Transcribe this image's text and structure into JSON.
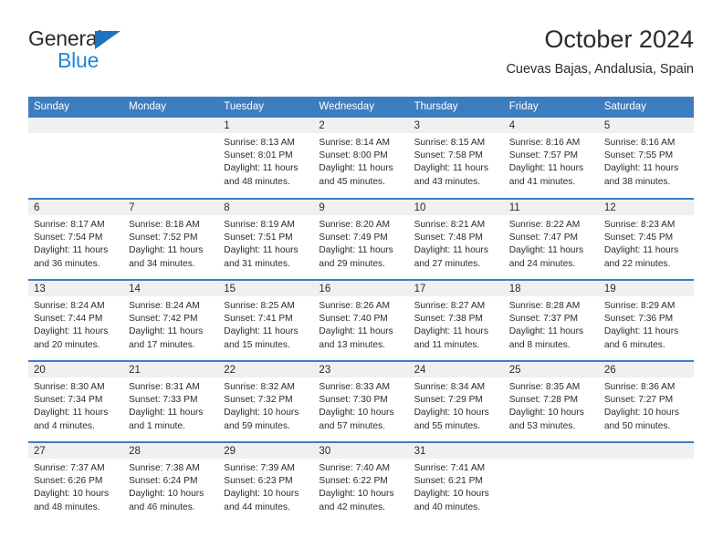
{
  "brand": {
    "line1": "General",
    "line2": "Blue",
    "line1_color": "#2b2b2b",
    "line2_color": "#1f86d8",
    "triangle_color": "#1f72bd"
  },
  "header": {
    "title": "October 2024",
    "subtitle": "Cuevas Bajas, Andalusia, Spain"
  },
  "theme": {
    "header_bg": "#3d7dbf",
    "header_text": "#ffffff",
    "daynum_bg": "#f0f0f0",
    "body_text": "#2b2b2b",
    "page_bg": "#ffffff"
  },
  "calendar": {
    "weekdays": [
      "Sunday",
      "Monday",
      "Tuesday",
      "Wednesday",
      "Thursday",
      "Friday",
      "Saturday"
    ],
    "weeks": [
      [
        {
          "day": "",
          "sunrise": "",
          "sunset": "",
          "daylight": "",
          "empty": true
        },
        {
          "day": "",
          "sunrise": "",
          "sunset": "",
          "daylight": "",
          "empty": true
        },
        {
          "day": "1",
          "sunrise": "Sunrise: 8:13 AM",
          "sunset": "Sunset: 8:01 PM",
          "daylight": "Daylight: 11 hours and 48 minutes."
        },
        {
          "day": "2",
          "sunrise": "Sunrise: 8:14 AM",
          "sunset": "Sunset: 8:00 PM",
          "daylight": "Daylight: 11 hours and 45 minutes."
        },
        {
          "day": "3",
          "sunrise": "Sunrise: 8:15 AM",
          "sunset": "Sunset: 7:58 PM",
          "daylight": "Daylight: 11 hours and 43 minutes."
        },
        {
          "day": "4",
          "sunrise": "Sunrise: 8:16 AM",
          "sunset": "Sunset: 7:57 PM",
          "daylight": "Daylight: 11 hours and 41 minutes."
        },
        {
          "day": "5",
          "sunrise": "Sunrise: 8:16 AM",
          "sunset": "Sunset: 7:55 PM",
          "daylight": "Daylight: 11 hours and 38 minutes."
        }
      ],
      [
        {
          "day": "6",
          "sunrise": "Sunrise: 8:17 AM",
          "sunset": "Sunset: 7:54 PM",
          "daylight": "Daylight: 11 hours and 36 minutes."
        },
        {
          "day": "7",
          "sunrise": "Sunrise: 8:18 AM",
          "sunset": "Sunset: 7:52 PM",
          "daylight": "Daylight: 11 hours and 34 minutes."
        },
        {
          "day": "8",
          "sunrise": "Sunrise: 8:19 AM",
          "sunset": "Sunset: 7:51 PM",
          "daylight": "Daylight: 11 hours and 31 minutes."
        },
        {
          "day": "9",
          "sunrise": "Sunrise: 8:20 AM",
          "sunset": "Sunset: 7:49 PM",
          "daylight": "Daylight: 11 hours and 29 minutes."
        },
        {
          "day": "10",
          "sunrise": "Sunrise: 8:21 AM",
          "sunset": "Sunset: 7:48 PM",
          "daylight": "Daylight: 11 hours and 27 minutes."
        },
        {
          "day": "11",
          "sunrise": "Sunrise: 8:22 AM",
          "sunset": "Sunset: 7:47 PM",
          "daylight": "Daylight: 11 hours and 24 minutes."
        },
        {
          "day": "12",
          "sunrise": "Sunrise: 8:23 AM",
          "sunset": "Sunset: 7:45 PM",
          "daylight": "Daylight: 11 hours and 22 minutes."
        }
      ],
      [
        {
          "day": "13",
          "sunrise": "Sunrise: 8:24 AM",
          "sunset": "Sunset: 7:44 PM",
          "daylight": "Daylight: 11 hours and 20 minutes."
        },
        {
          "day": "14",
          "sunrise": "Sunrise: 8:24 AM",
          "sunset": "Sunset: 7:42 PM",
          "daylight": "Daylight: 11 hours and 17 minutes."
        },
        {
          "day": "15",
          "sunrise": "Sunrise: 8:25 AM",
          "sunset": "Sunset: 7:41 PM",
          "daylight": "Daylight: 11 hours and 15 minutes."
        },
        {
          "day": "16",
          "sunrise": "Sunrise: 8:26 AM",
          "sunset": "Sunset: 7:40 PM",
          "daylight": "Daylight: 11 hours and 13 minutes."
        },
        {
          "day": "17",
          "sunrise": "Sunrise: 8:27 AM",
          "sunset": "Sunset: 7:38 PM",
          "daylight": "Daylight: 11 hours and 11 minutes."
        },
        {
          "day": "18",
          "sunrise": "Sunrise: 8:28 AM",
          "sunset": "Sunset: 7:37 PM",
          "daylight": "Daylight: 11 hours and 8 minutes."
        },
        {
          "day": "19",
          "sunrise": "Sunrise: 8:29 AM",
          "sunset": "Sunset: 7:36 PM",
          "daylight": "Daylight: 11 hours and 6 minutes."
        }
      ],
      [
        {
          "day": "20",
          "sunrise": "Sunrise: 8:30 AM",
          "sunset": "Sunset: 7:34 PM",
          "daylight": "Daylight: 11 hours and 4 minutes."
        },
        {
          "day": "21",
          "sunrise": "Sunrise: 8:31 AM",
          "sunset": "Sunset: 7:33 PM",
          "daylight": "Daylight: 11 hours and 1 minute."
        },
        {
          "day": "22",
          "sunrise": "Sunrise: 8:32 AM",
          "sunset": "Sunset: 7:32 PM",
          "daylight": "Daylight: 10 hours and 59 minutes."
        },
        {
          "day": "23",
          "sunrise": "Sunrise: 8:33 AM",
          "sunset": "Sunset: 7:30 PM",
          "daylight": "Daylight: 10 hours and 57 minutes."
        },
        {
          "day": "24",
          "sunrise": "Sunrise: 8:34 AM",
          "sunset": "Sunset: 7:29 PM",
          "daylight": "Daylight: 10 hours and 55 minutes."
        },
        {
          "day": "25",
          "sunrise": "Sunrise: 8:35 AM",
          "sunset": "Sunset: 7:28 PM",
          "daylight": "Daylight: 10 hours and 53 minutes."
        },
        {
          "day": "26",
          "sunrise": "Sunrise: 8:36 AM",
          "sunset": "Sunset: 7:27 PM",
          "daylight": "Daylight: 10 hours and 50 minutes."
        }
      ],
      [
        {
          "day": "27",
          "sunrise": "Sunrise: 7:37 AM",
          "sunset": "Sunset: 6:26 PM",
          "daylight": "Daylight: 10 hours and 48 minutes."
        },
        {
          "day": "28",
          "sunrise": "Sunrise: 7:38 AM",
          "sunset": "Sunset: 6:24 PM",
          "daylight": "Daylight: 10 hours and 46 minutes."
        },
        {
          "day": "29",
          "sunrise": "Sunrise: 7:39 AM",
          "sunset": "Sunset: 6:23 PM",
          "daylight": "Daylight: 10 hours and 44 minutes."
        },
        {
          "day": "30",
          "sunrise": "Sunrise: 7:40 AM",
          "sunset": "Sunset: 6:22 PM",
          "daylight": "Daylight: 10 hours and 42 minutes."
        },
        {
          "day": "31",
          "sunrise": "Sunrise: 7:41 AM",
          "sunset": "Sunset: 6:21 PM",
          "daylight": "Daylight: 10 hours and 40 minutes."
        },
        {
          "day": "",
          "sunrise": "",
          "sunset": "",
          "daylight": "",
          "empty": true
        },
        {
          "day": "",
          "sunrise": "",
          "sunset": "",
          "daylight": "",
          "empty": true
        }
      ]
    ]
  }
}
